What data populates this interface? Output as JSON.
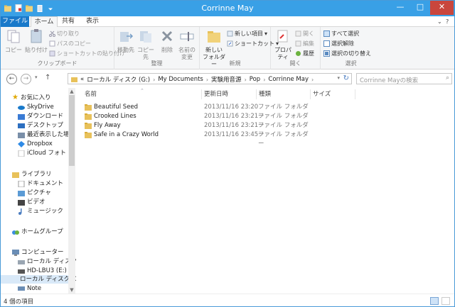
{
  "window": {
    "title": "Corrinne May",
    "controls": {
      "minimize": "—",
      "maximize": "□",
      "close": "✕"
    }
  },
  "tabs": {
    "file": "ファイル",
    "home": "ホーム",
    "share": "共有",
    "view": "表示"
  },
  "ribbon": {
    "clipboard": {
      "label": "クリップボード",
      "copy": "コピー",
      "paste": "貼り付け",
      "cut": "切り取り",
      "copy_path": "パスのコピー",
      "paste_shortcut": "ショートカットの貼り付け"
    },
    "organize": {
      "label": "整理",
      "move_to": "移動先",
      "copy_to": "コピー先",
      "delete": "削除",
      "rename_line1": "名前の",
      "rename_line2": "変更"
    },
    "new": {
      "label": "新規",
      "new_folder_line1": "新しい",
      "new_folder_line2": "フォルダー",
      "new_item": "新しい項目",
      "easy_access": "ショートカット"
    },
    "open": {
      "label": "開く",
      "properties": "プロパティ",
      "open": "開く",
      "edit": "編集",
      "history": "履歴"
    },
    "select": {
      "label": "選択",
      "select_all": "すべて選択",
      "select_none": "選択解除",
      "invert": "選択の切り替え"
    }
  },
  "address": {
    "back": "←",
    "forward": "→",
    "crumbs": [
      "«",
      "ローカル ディスク (G:)",
      "My Documents",
      "実験用音源",
      "Pop",
      "Corrinne May"
    ],
    "search_placeholder": "Corrinne Mayの検索"
  },
  "nav": {
    "favorites": "お気に入り",
    "skydrive": "SkyDrive",
    "downloads": "ダウンロード",
    "desktop": "デスクトップ",
    "recent": "最近表示した場所",
    "dropbox": "Dropbox",
    "icloud": "iCloud フォト",
    "libraries": "ライブラリ",
    "documents": "ドキュメント",
    "pictures": "ピクチャ",
    "videos": "ビデオ",
    "music": "ミュージック",
    "homegroup": "ホームグループ",
    "computer": "コンピューター",
    "local_c": "ローカル ディスク (C",
    "hd_lbu3": "HD-LBU3 (E:)",
    "local_g": "ローカル ディスク (G",
    "note": "Note"
  },
  "columns": {
    "name": "名前",
    "date": "更新日時",
    "type": "種類",
    "size": "サイズ"
  },
  "files": [
    {
      "name": "Beautiful Seed",
      "date": "2013/11/16 23:20",
      "type": "ファイル フォルダー"
    },
    {
      "name": "Crooked Lines",
      "date": "2013/11/16 23:21",
      "type": "ファイル フォルダー"
    },
    {
      "name": "Fly Away",
      "date": "2013/11/16 23:21",
      "type": "ファイル フォルダー"
    },
    {
      "name": "Safe in a Crazy World",
      "date": "2013/11/16 23:45",
      "type": "ファイル フォルダー"
    }
  ],
  "status": {
    "count": "4 個の項目"
  },
  "colors": {
    "title_bar": "#39a0e6",
    "file_tab": "#1979ca",
    "folder": "#e8c15a",
    "close_button": "#c9463d"
  }
}
